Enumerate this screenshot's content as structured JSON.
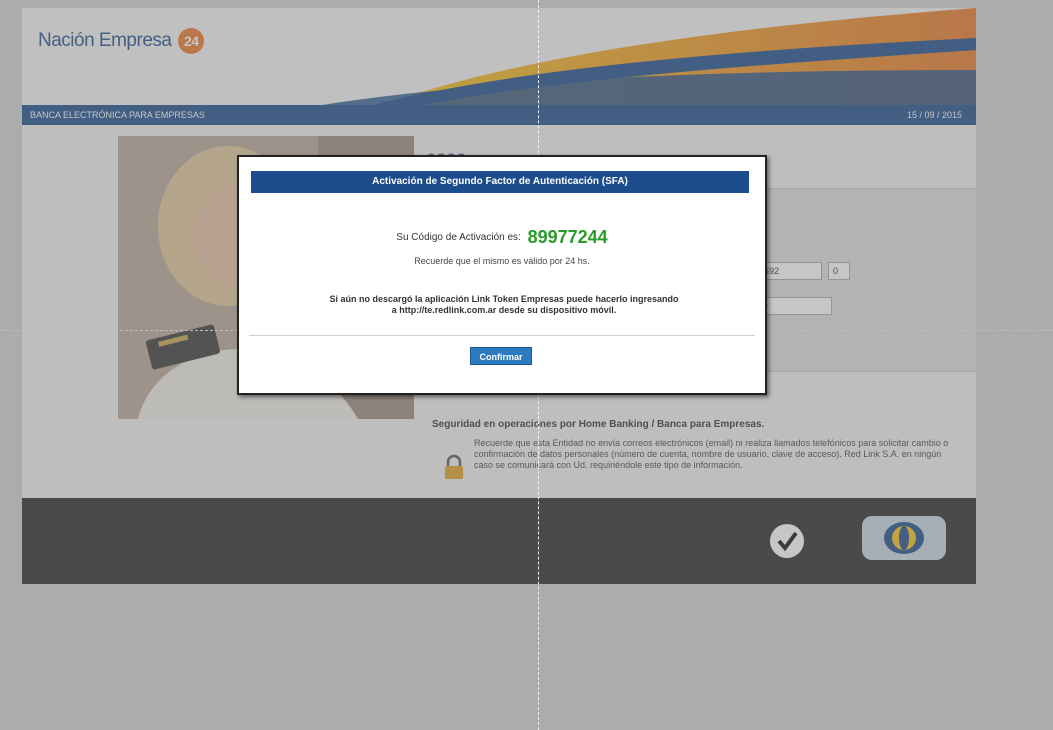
{
  "brand": {
    "name": "Nación Empresa",
    "badge": "24"
  },
  "nav": {
    "title": "BANCA ELECTRÓNICA PARA EMPRESAS",
    "date": "15 / 09 / 2015"
  },
  "main": {
    "title_fragment": "esas"
  },
  "login": {
    "field1_value": "693592",
    "field2_value": "0",
    "password_mask": "••••••"
  },
  "security": {
    "title": "Seguridad en operaciones por Home Banking / Banca para Empresas.",
    "text": "Recuerde que esta Entidad no envía correos electrónicos (email) ni realiza llamados telefónicos para solicitar cambio o confirmación de datos personales (número de cuenta, nombre de usuario, clave de acceso). Red Link S.A. en ningún caso se comunicará con Ud. requiriéndole este tipo de información."
  },
  "modal": {
    "title": "Activación de Segundo Factor de Autenticación (SFA)",
    "code_label": "Su Código de Activación es:",
    "code_value": "89977244",
    "validity": "Recuerde que el mismo es válido por 24 hs.",
    "note_line1": "Si aún no descargó la aplicación Link Token Empresas puede hacerlo ingresando",
    "note_line2": "a http://te.redlink.com.ar desde su dispositivo móvil.",
    "confirm_label": "Confirmar"
  },
  "icons": [
    "lock-icon",
    "checkmark-icon",
    "banelco-icon"
  ],
  "colors": {
    "brand_blue": "#1c4c8c",
    "code_green": "#2a9a2a",
    "button_blue": "#2b7bc0",
    "accent_orange": "#e8782a"
  }
}
